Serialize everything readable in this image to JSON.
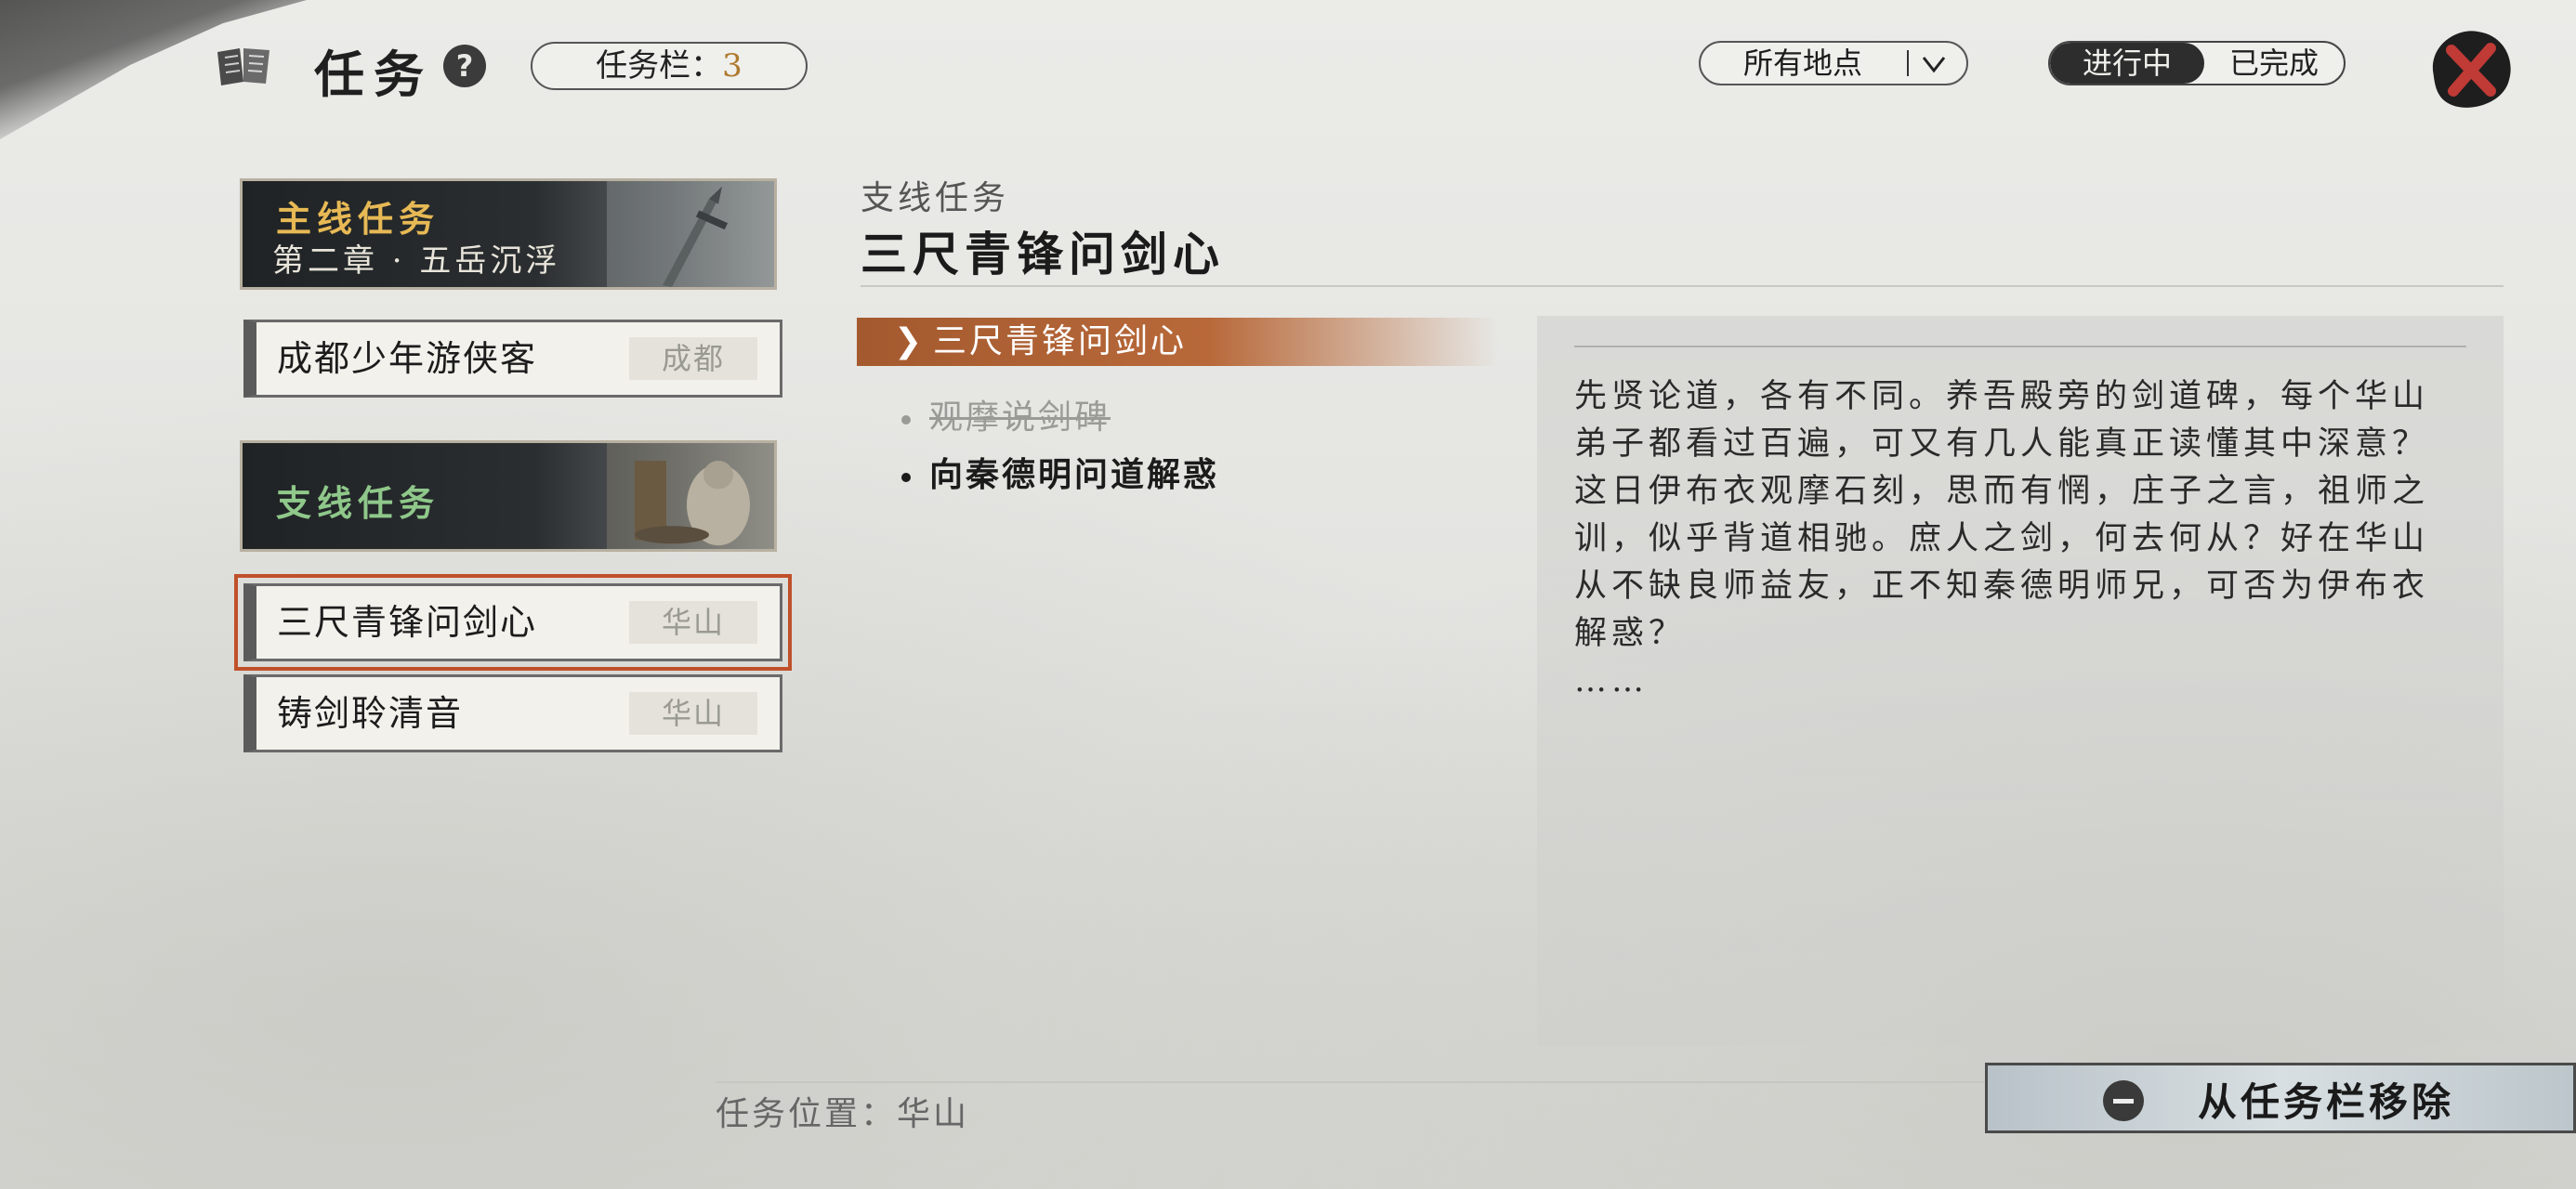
{
  "header": {
    "title": "任务",
    "help": "?",
    "slots_label": "任务栏：",
    "slots_count": "3",
    "location_filter": "所有地点",
    "status_tabs": [
      {
        "label": "进行中",
        "active": true
      },
      {
        "label": "已完成",
        "active": false
      }
    ]
  },
  "quest_list": {
    "main": {
      "category": "主线任务",
      "chapter": "第二章 · 五岳沉浮",
      "items": [
        {
          "name": "成都少年游侠客",
          "location": "成都"
        }
      ]
    },
    "side": {
      "category": "支线任务",
      "items": [
        {
          "name": "三尺青锋问剑心",
          "location": "华山",
          "selected": true
        },
        {
          "name": "铸剑聆清音",
          "location": "华山",
          "selected": false
        }
      ]
    }
  },
  "detail": {
    "category": "支线任务",
    "title": "三尺青锋问剑心",
    "objective_header": "三尺青锋问剑心",
    "objectives": [
      {
        "text": "观摩说剑碑",
        "completed": true
      },
      {
        "text": "向秦德明问道解惑",
        "completed": false
      }
    ],
    "description": "先贤论道，各有不同。养吾殿旁的剑道碑，每个华山\n弟子都看过百遍，可又有几人能真正读懂其中深意？\n这日伊布衣观摩石刻，思而有惘，庄子之言，祖师之\n训，似乎背道相驰。庶人之剑，何去何从？好在华山\n从不缺良师益友，正不知秦德明师兄，可否为伊布衣\n解惑？\n……"
  },
  "footer": {
    "location_text": "任务位置：华山",
    "remove_button": "从任务栏移除"
  },
  "colors": {
    "accent_gold": "#e7b955",
    "accent_green": "#8fc88a",
    "objective_bar": "#a45a2e",
    "selected_outline": "#c0502a",
    "slot_count": "#b07a2e"
  }
}
